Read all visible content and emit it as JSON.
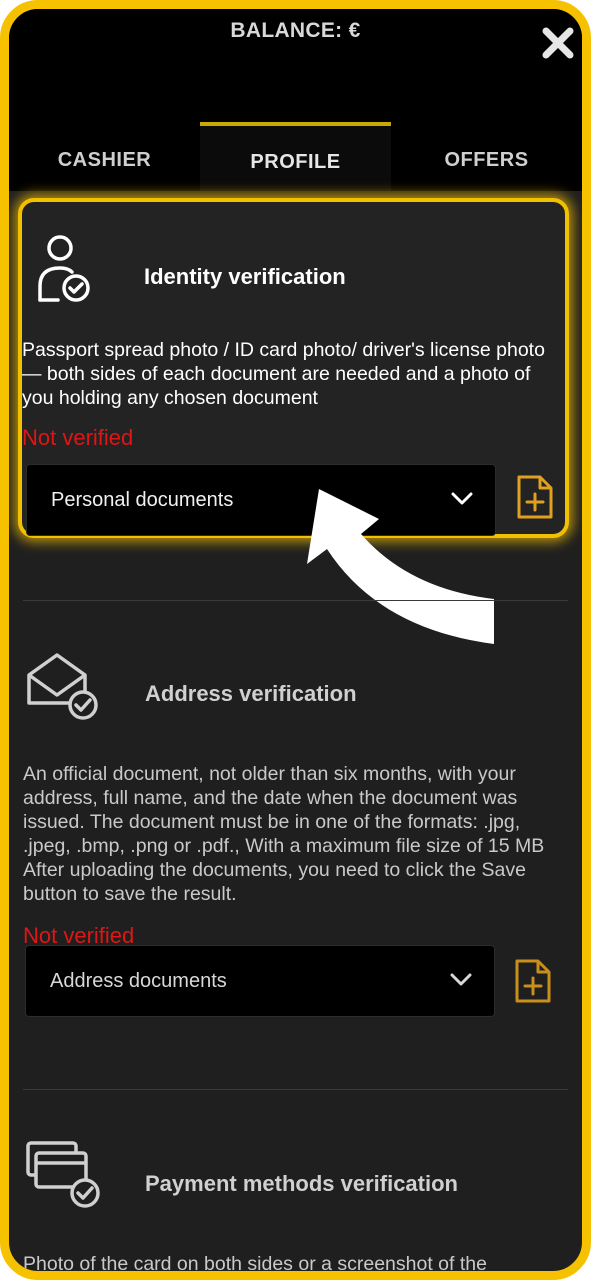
{
  "header": {
    "balance": "BALANCE: €"
  },
  "tabs": [
    {
      "label": "CASHIER",
      "active": false
    },
    {
      "label": "PROFILE",
      "active": true
    },
    {
      "label": "OFFERS",
      "active": false
    }
  ],
  "sections": [
    {
      "icon": "user-check-icon",
      "title": "Identity verification",
      "description": "Passport spread photo / ID card photo/ driver's license photo — both sides of each document are needed and a photo of you holding any chosen document",
      "status": "Not verified",
      "select_value": "Personal documents"
    },
    {
      "icon": "envelope-check-icon",
      "title": "Address verification",
      "description": "An official document, not older than six months, with your address, full name, and the date when the document was issued. The document must be in one of the formats: .jpg, .jpeg, .bmp, .png or .pdf., With a maximum file size of 15 MB After uploading the documents, you need to click the Save button to save the result.",
      "status": "Not verified",
      "select_value": "Address documents"
    },
    {
      "icon": "cards-check-icon",
      "title": "Payment methods verification",
      "description": "Photo of the card on both sides or a screenshot of the"
    }
  ],
  "colors": {
    "frame": "#f6c200",
    "status_red": "#e01515",
    "upload_icon": "#e0a020"
  }
}
